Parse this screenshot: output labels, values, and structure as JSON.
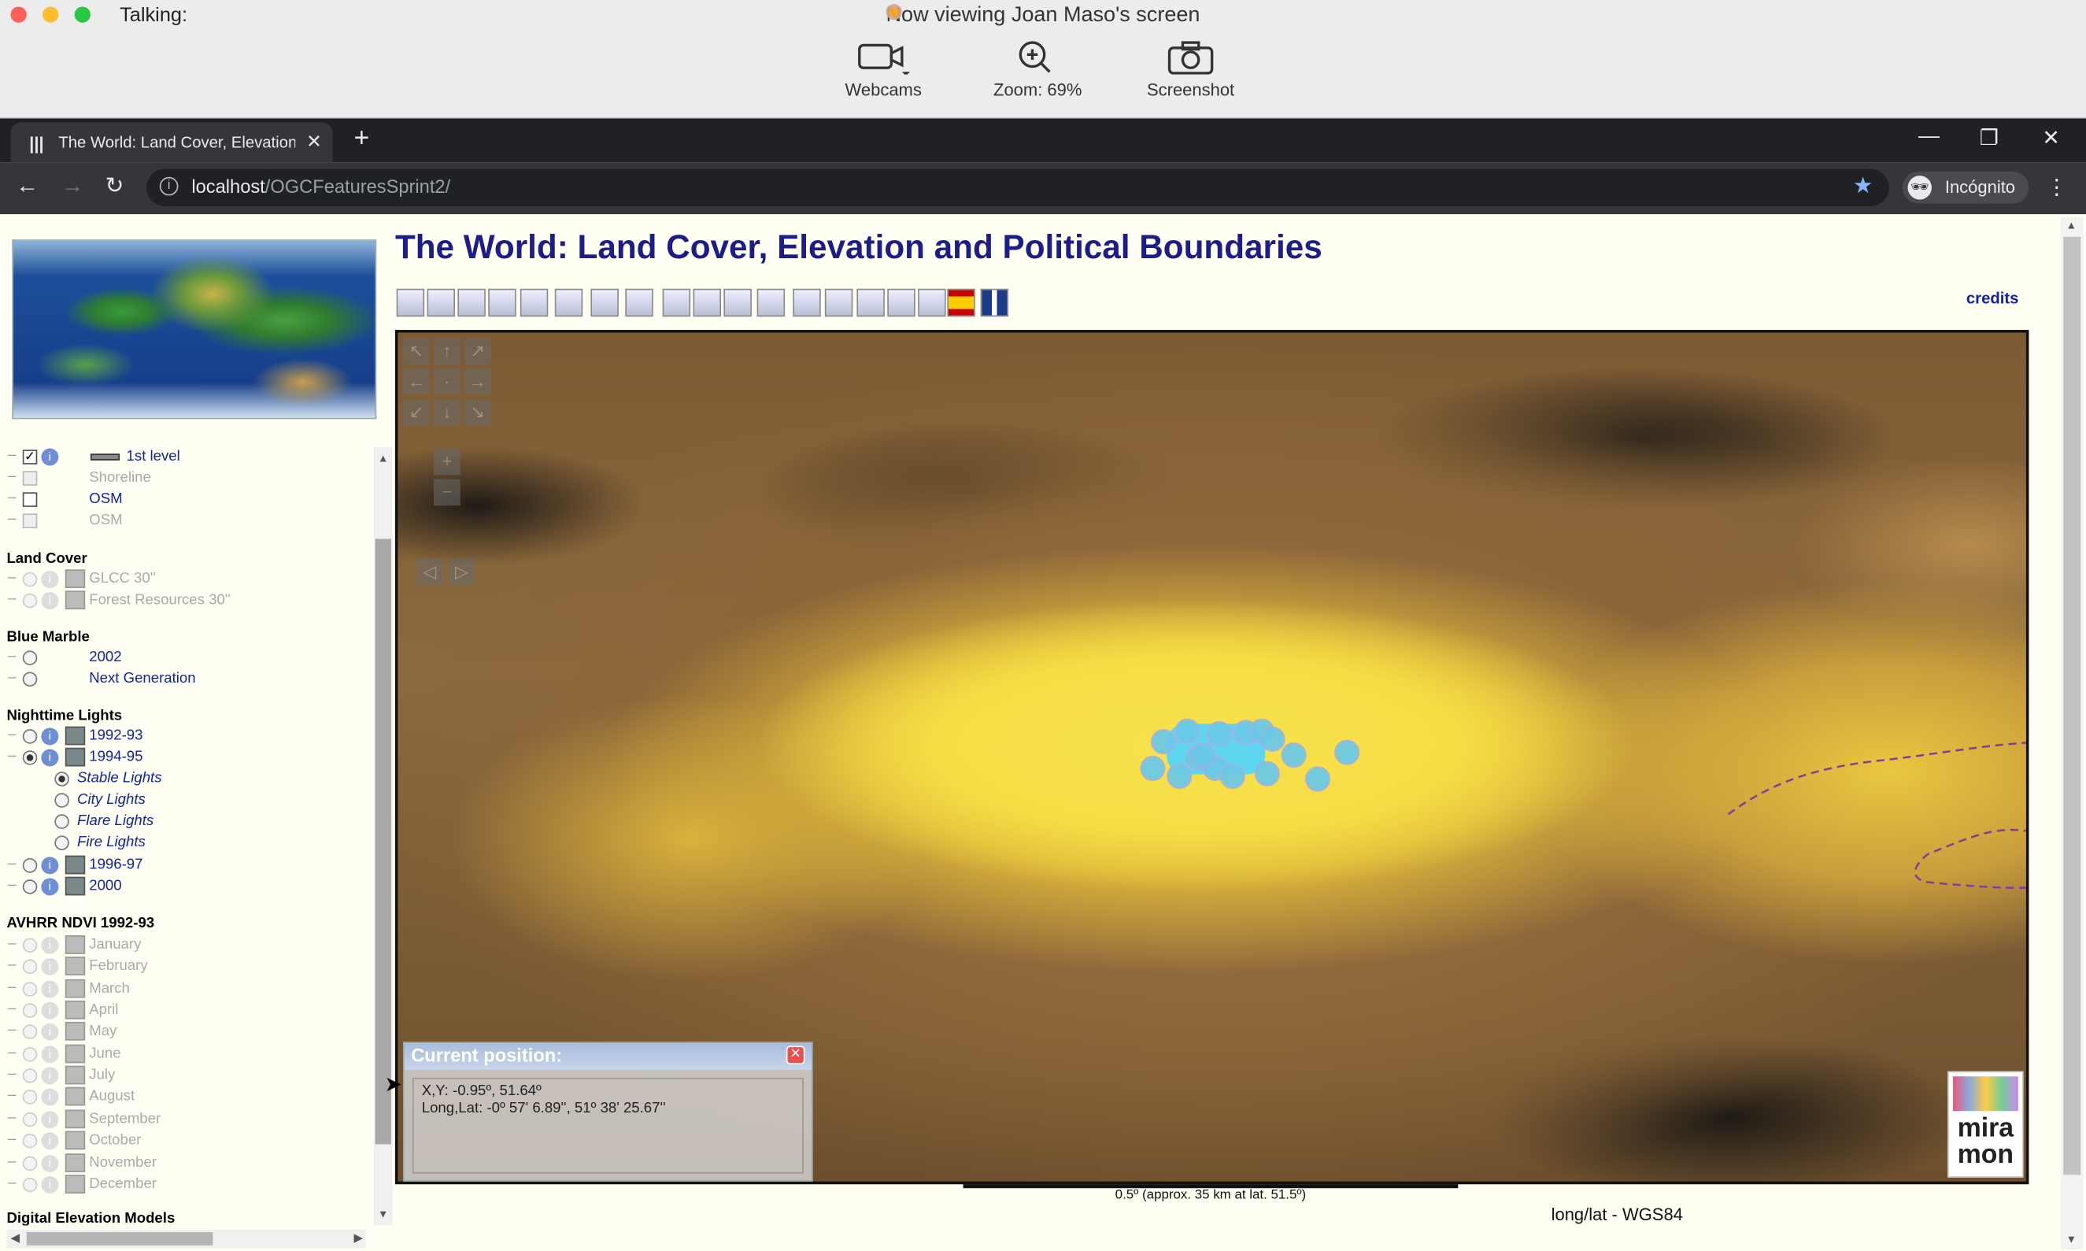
{
  "zoombar": {
    "talking": "Talking:",
    "viewing": "Now viewing Joan Maso's screen",
    "webcams": "Webcams",
    "zoom": "Zoom: 69%",
    "screenshot": "Screenshot"
  },
  "browser": {
    "tab_title": "The World: Land Cover, Elevation",
    "url_host": "localhost",
    "url_path": "/OGCFeaturesSprint2/",
    "incognito": "Incógnito"
  },
  "page": {
    "title": "The World: Land Cover, Elevation and Political Boundaries",
    "credits": "credits"
  },
  "legend": {
    "top_items": [
      "1st level",
      "Shoreline",
      "OSM",
      "OSM"
    ],
    "land_cover": {
      "title": "Land Cover",
      "items": [
        "GLCC 30''",
        "Forest Resources 30''"
      ]
    },
    "blue_marble": {
      "title": "Blue Marble",
      "items": [
        "2002",
        "Next Generation"
      ]
    },
    "nighttime": {
      "title": "Nighttime Lights",
      "items": [
        "1992-93",
        "1994-95",
        "1996-97",
        "2000"
      ],
      "sub_items": [
        "Stable Lights",
        "City Lights",
        "Flare Lights",
        "Fire Lights"
      ]
    },
    "ndvi": {
      "title": "AVHRR NDVI 1992-93",
      "months": [
        "January",
        "February",
        "March",
        "April",
        "May",
        "June",
        "July",
        "August",
        "September",
        "October",
        "November",
        "December"
      ]
    },
    "dem": {
      "title": "Digital Elevation Models"
    }
  },
  "position_box": {
    "title": "Current position:",
    "xy": "X,Y: -0.95º, 51.64º",
    "longlat": "Long,Lat: -0º 57' 6.89'', 51º 38' 25.67''"
  },
  "map": {
    "scale_text": "0.5º (approx. 35 km at lat. 51.5º)",
    "crs": "long/lat - WGS84",
    "logo_text": "mira mon"
  },
  "colors": {
    "title": "#1c1c8a",
    "link": "#1122aa",
    "feature_points": "#69c8e8"
  }
}
